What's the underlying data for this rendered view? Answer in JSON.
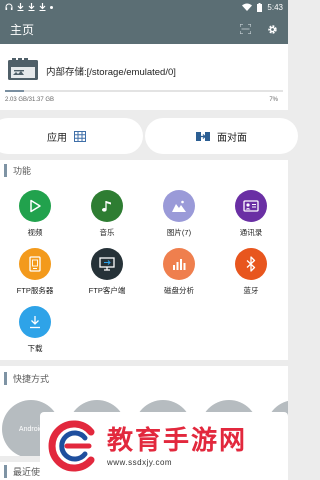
{
  "status_bar": {
    "time": "5:43"
  },
  "app_bar": {
    "title": "主页"
  },
  "storage": {
    "path": "内部存储:[/storage/emulated/0]",
    "used": "2.03 GB/31.37 GB",
    "percent": "7%",
    "fill_fraction": 0.07
  },
  "toggles": {
    "apps": "应用",
    "face_to_face": "面对面"
  },
  "functions": {
    "header": "功能",
    "items": [
      {
        "label": "视频",
        "icon": "play-icon",
        "color": "#21a24d"
      },
      {
        "label": "音乐",
        "icon": "music-note-icon",
        "color": "#2e7d32"
      },
      {
        "label": "图片(7)",
        "icon": "image-icon",
        "color": "#9a9ad8"
      },
      {
        "label": "通讯录",
        "icon": "contact-card-icon",
        "color": "#6a2fa4"
      },
      {
        "label": "FTP服务器",
        "icon": "ftp-server-icon",
        "color": "#f39a1c"
      },
      {
        "label": "FTP客户端",
        "icon": "ftp-client-icon",
        "color": "#263238"
      },
      {
        "label": "磁盘分析",
        "icon": "disk-analysis-icon",
        "color": "#ef7f4e"
      },
      {
        "label": "蓝牙",
        "icon": "bluetooth-icon",
        "color": "#e8561e"
      },
      {
        "label": "下载",
        "icon": "download-icon",
        "color": "#2ea3e8"
      }
    ]
  },
  "shortcuts": {
    "header": "快捷方式",
    "items": [
      "Android",
      "",
      "",
      "",
      ""
    ]
  },
  "recent": {
    "header": "最近使"
  },
  "watermark": {
    "title": "教育手游网",
    "url": "www.ssdxjy.com"
  },
  "colors": {
    "app_bar": "#5b6e74",
    "accent": "#7e93a4",
    "watermark_red": "#e2283d"
  }
}
